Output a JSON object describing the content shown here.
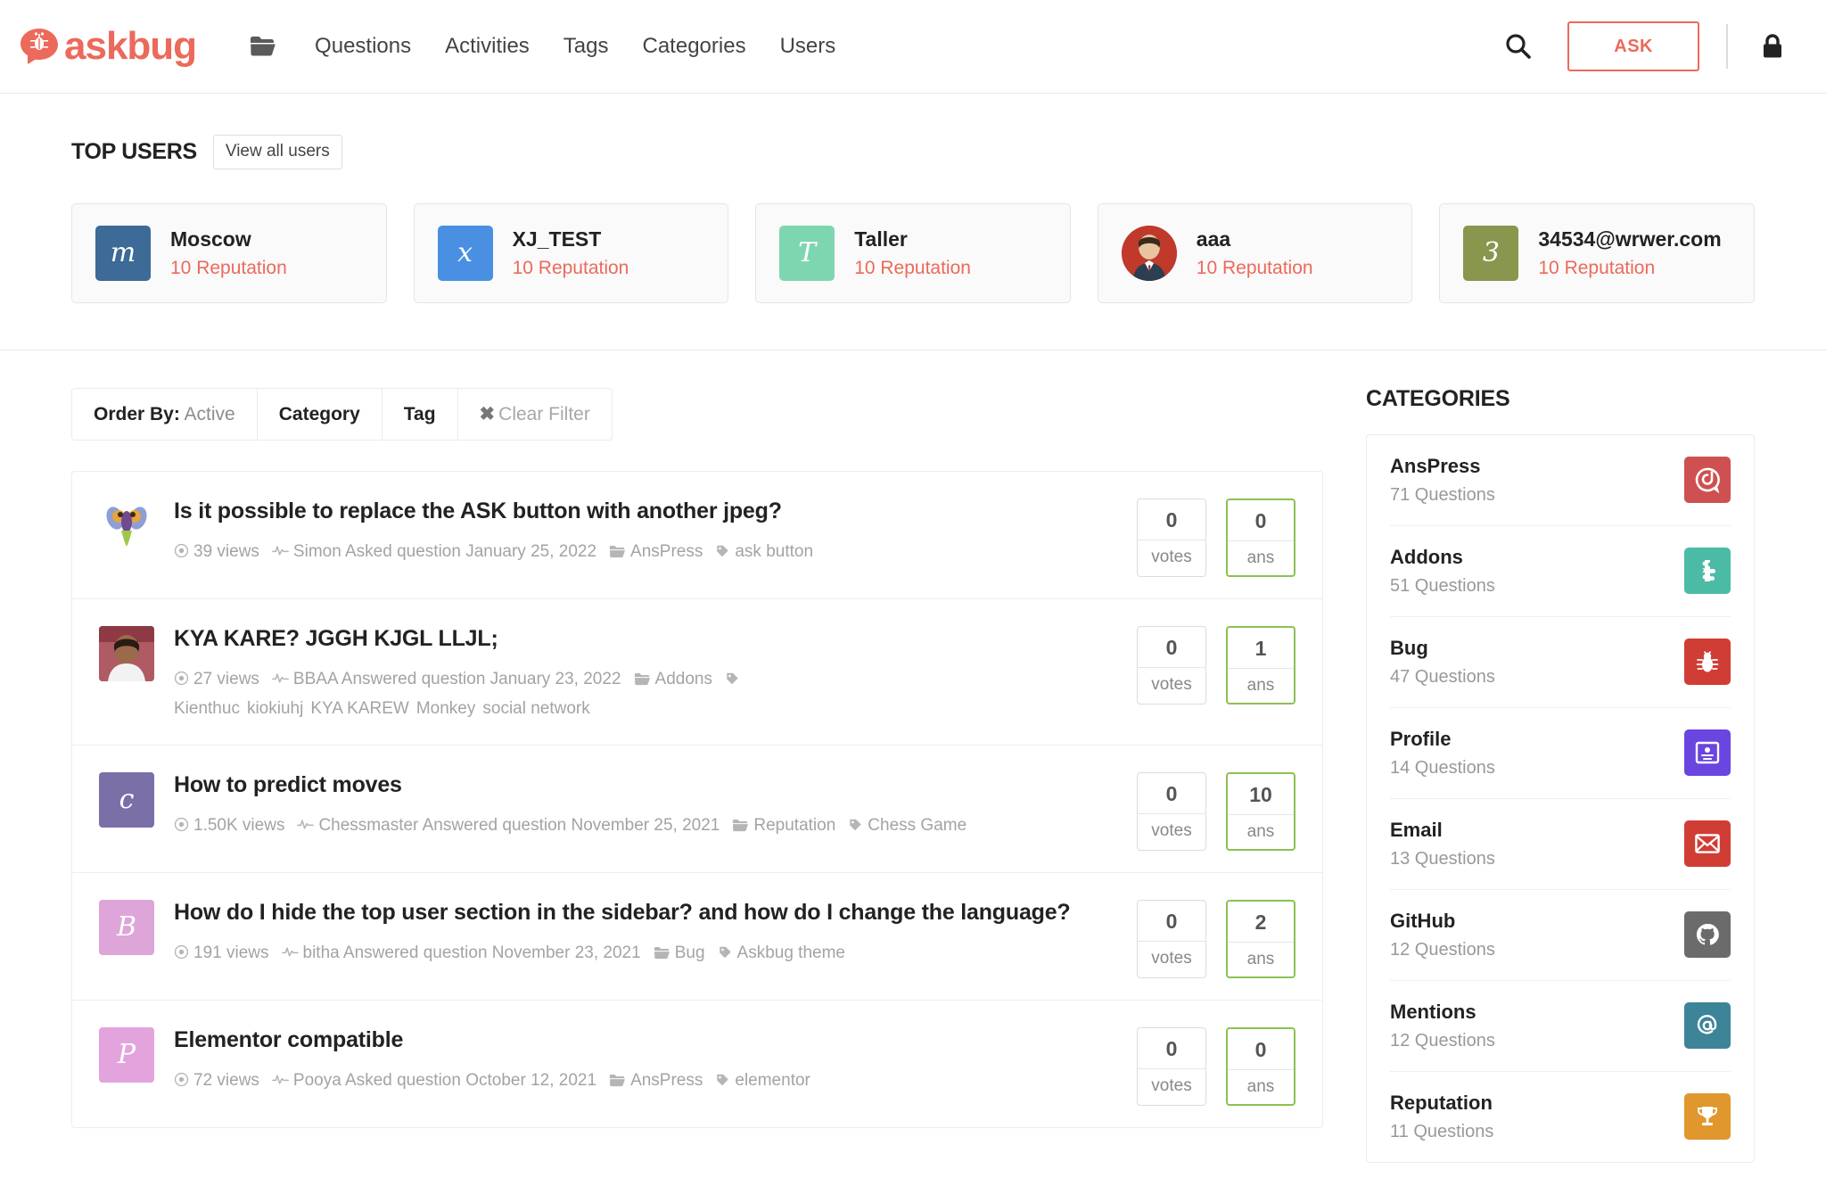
{
  "header": {
    "logo_text": "askbug",
    "logo_icon": "bug-speech-bubble-icon",
    "folder_icon": "folder-icon",
    "nav": [
      {
        "label": "Questions"
      },
      {
        "label": "Activities"
      },
      {
        "label": "Tags"
      },
      {
        "label": "Categories"
      },
      {
        "label": "Users"
      }
    ],
    "search_icon": "search-icon",
    "ask_label": "ASK",
    "lock_icon": "lock-icon",
    "accent_color": "#eb6a5b"
  },
  "top_users": {
    "title": "TOP USERS",
    "view_all_label": "View all users",
    "users": [
      {
        "name": "Moscow",
        "reputation": "10 Reputation",
        "initial": "m",
        "avatar_color": "#3d6a96",
        "avatar_type": "letter"
      },
      {
        "name": "XJ_TEST",
        "reputation": "10 Reputation",
        "initial": "x",
        "avatar_color": "#4a90e2",
        "avatar_type": "letter"
      },
      {
        "name": "Taller",
        "reputation": "10 Reputation",
        "initial": "T",
        "avatar_color": "#7ed6b0",
        "avatar_type": "letter"
      },
      {
        "name": "aaa",
        "reputation": "10 Reputation",
        "initial": "",
        "avatar_color": "#b03a2e",
        "avatar_type": "photo"
      },
      {
        "name": "34534@wrwer.com",
        "reputation": "10 Reputation",
        "initial": "3",
        "avatar_color": "#88964e",
        "avatar_type": "letter"
      }
    ]
  },
  "filters": {
    "order_by_label": "Order By:",
    "order_by_value": "Active",
    "category_label": "Category",
    "tag_label": "Tag",
    "clear_label": "Clear Filter",
    "clear_icon": "x-icon"
  },
  "questions": [
    {
      "title": "Is it possible to replace the ASK button with another jpeg?",
      "views": "39 views",
      "activity": "Simon Asked question January 25, 2022",
      "category": "AnsPress",
      "tags": [
        "ask button"
      ],
      "votes": "0",
      "votes_label": "votes",
      "answers": "0",
      "answers_label": "ans",
      "avatar_type": "image-butterfly",
      "avatar_color": "#ffffff",
      "avatar_initial": ""
    },
    {
      "title": "KYA KARE? JGGH KJGL LLJL;",
      "views": "27 views",
      "activity": "BBAA Answered question January 23, 2022",
      "category": "Addons",
      "tags": [
        "Kienthuc",
        "kiokiuhj",
        "KYA KAREW",
        "Monkey",
        "social network"
      ],
      "votes": "0",
      "votes_label": "votes",
      "answers": "1",
      "answers_label": "ans",
      "avatar_type": "image-portrait",
      "avatar_color": "#a8555f",
      "avatar_initial": ""
    },
    {
      "title": "How to predict moves",
      "views": "1.50K views",
      "activity": "Chessmaster Answered question November 25, 2021",
      "category": "Reputation",
      "tags": [
        "Chess Game"
      ],
      "votes": "0",
      "votes_label": "votes",
      "answers": "10",
      "answers_label": "ans",
      "avatar_type": "letter",
      "avatar_color": "#7b6fa8",
      "avatar_initial": "c"
    },
    {
      "title": "How do I hide the top user section in the sidebar? and how do I change the language?",
      "views": "191 views",
      "activity": "bitha Answered question November 23, 2021",
      "category": "Bug",
      "tags": [
        "Askbug theme"
      ],
      "votes": "0",
      "votes_label": "votes",
      "answers": "2",
      "answers_label": "ans",
      "avatar_type": "letter",
      "avatar_color": "#dda5d8",
      "avatar_initial": "B"
    },
    {
      "title": "Elementor compatible",
      "views": "72 views",
      "activity": "Pooya Asked question October 12, 2021",
      "category": "AnsPress",
      "tags": [
        "elementor"
      ],
      "votes": "0",
      "votes_label": "votes",
      "answers": "0",
      "answers_label": "ans",
      "avatar_type": "letter",
      "avatar_color": "#e3a4dd",
      "avatar_initial": "P"
    }
  ],
  "sidebar": {
    "title": "CATEGORIES",
    "categories": [
      {
        "name": "AnsPress",
        "count": "71 Questions",
        "icon": "anspress-icon",
        "glyph": "ⓐ",
        "color": "#cf5050"
      },
      {
        "name": "Addons",
        "count": "51 Questions",
        "icon": "puzzle-icon",
        "glyph": "❖",
        "color": "#4cbba5"
      },
      {
        "name": "Bug",
        "count": "47 Questions",
        "icon": "bug-icon",
        "glyph": "☣",
        "color": "#cf3d35"
      },
      {
        "name": "Profile",
        "count": "14 Questions",
        "icon": "id-card-icon",
        "glyph": "▣",
        "color": "#6a45e0"
      },
      {
        "name": "Email",
        "count": "13 Questions",
        "icon": "envelope-icon",
        "glyph": "✉",
        "color": "#cf3d35"
      },
      {
        "name": "GitHub",
        "count": "12 Questions",
        "icon": "github-icon",
        "glyph": "●",
        "color": "#6b6b6b"
      },
      {
        "name": "Mentions",
        "count": "12 Questions",
        "icon": "at-icon",
        "glyph": "@",
        "color": "#3d8499"
      },
      {
        "name": "Reputation",
        "count": "11 Questions",
        "icon": "trophy-icon",
        "glyph": "⚑",
        "color": "#e0972e"
      }
    ]
  }
}
